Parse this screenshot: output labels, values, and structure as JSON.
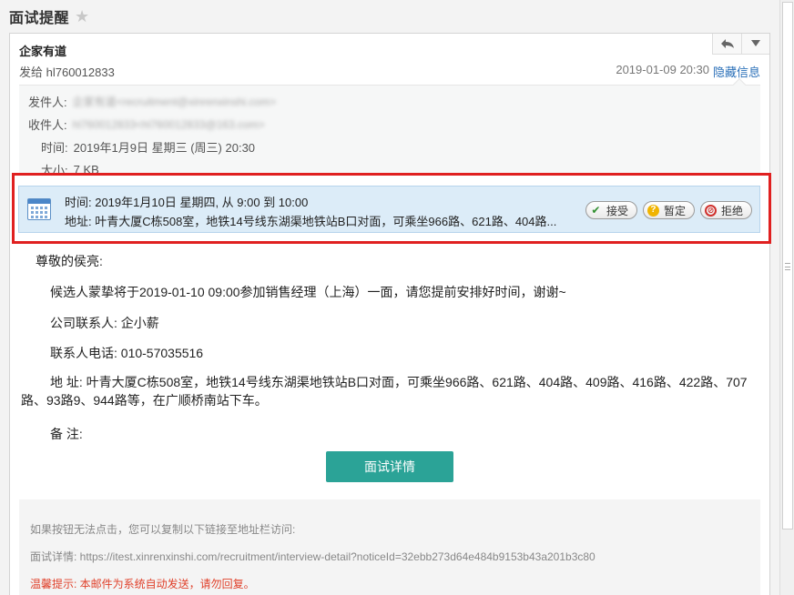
{
  "page": {
    "title": "面试提醒"
  },
  "mail": {
    "sender_name": "企家有道",
    "send_to": "发给 hl760012833",
    "date": "2019-01-09 20:30",
    "hide_info_label": "隐藏信息"
  },
  "details": {
    "from_label": "发件人:",
    "from_value": "企家有道<recruitment@xinrenxinshi.com>",
    "to_label": "收件人:",
    "to_value": "hl760012833<hl760012833@163.com>",
    "time_label": "时间:",
    "time_value": "2019年1月9日 星期三 (周三) 20:30",
    "size_label": "大小:",
    "size_value": "7 KB"
  },
  "calendar": {
    "time_line": "时间: 2019年1月10日 星期四, 从 9:00 到 10:00",
    "address_line": "地址: 叶青大厦C栋508室，地铁14号线东湖渠地铁站B口对面，可乘坐966路、621路、404路...",
    "accept_label": "接受",
    "tentative_label": "暂定",
    "decline_label": "拒绝"
  },
  "body": {
    "greeting": "尊敬的侯亮:",
    "line1": "候选人蒙挚将于2019-01-10 09:00参加销售经理（上海）一面，请您提前安排好时间，谢谢~",
    "contact": "公司联系人:   企小薪",
    "phone": "联系人电话:   010-57035516",
    "address": "地 址:   叶青大厦C栋508室，地铁14号线东湖渠地铁站B口对面，可乘坐966路、621路、404路、409路、416路、422路、707路、93路9、944路等，在广顺桥南站下车。",
    "remark": "备 注:",
    "detail_button": "面试详情"
  },
  "footer": {
    "hint": "如果按钮无法点击，您可以复制以下链接至地址栏访问:",
    "link": "面试详情:  https://itest.xinrenxinshi.com/recruitment/interview-detail?noticeId=32ebb273d64e484b9153b43a201b3c80",
    "warning": "温馨提示:  本邮件为系统自动发送，请勿回复。"
  }
}
